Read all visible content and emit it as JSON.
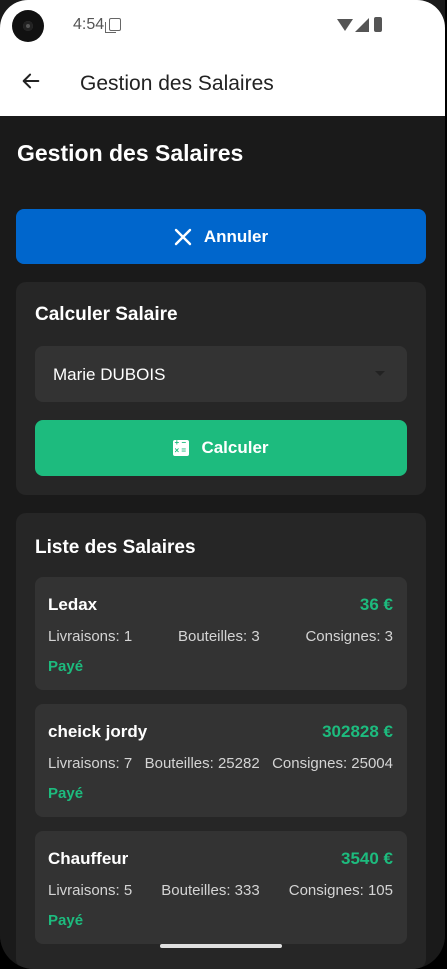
{
  "status_bar": {
    "time": "4:54"
  },
  "app_bar": {
    "title": "Gestion des Salaires"
  },
  "page": {
    "title": "Gestion des Salaires"
  },
  "cancel_button": {
    "label": "Annuler"
  },
  "calculate_card": {
    "title": "Calculer Salaire",
    "selected_employee": "Marie DUBOIS",
    "button_label": "Calculer"
  },
  "salary_list": {
    "title": "Liste des Salaires",
    "items": [
      {
        "name": "Ledax",
        "amount": "36 €",
        "deliveries": "Livraisons: 1",
        "bottles": "Bouteilles: 3",
        "deposits": "Consignes: 3",
        "status": "Payé"
      },
      {
        "name": "cheick jordy",
        "amount": "302828 €",
        "deliveries": "Livraisons: 7",
        "bottles": "Bouteilles: 25282",
        "deposits": "Consignes: 25004",
        "status": "Payé"
      },
      {
        "name": "Chauffeur",
        "amount": "3540 €",
        "deliveries": "Livraisons: 5",
        "bottles": "Bouteilles: 333",
        "deposits": "Consignes: 105",
        "status": "Payé"
      }
    ]
  },
  "colors": {
    "accent_blue": "#0066cc",
    "accent_green": "#1dbb7e",
    "background": "#1a1a1a"
  }
}
